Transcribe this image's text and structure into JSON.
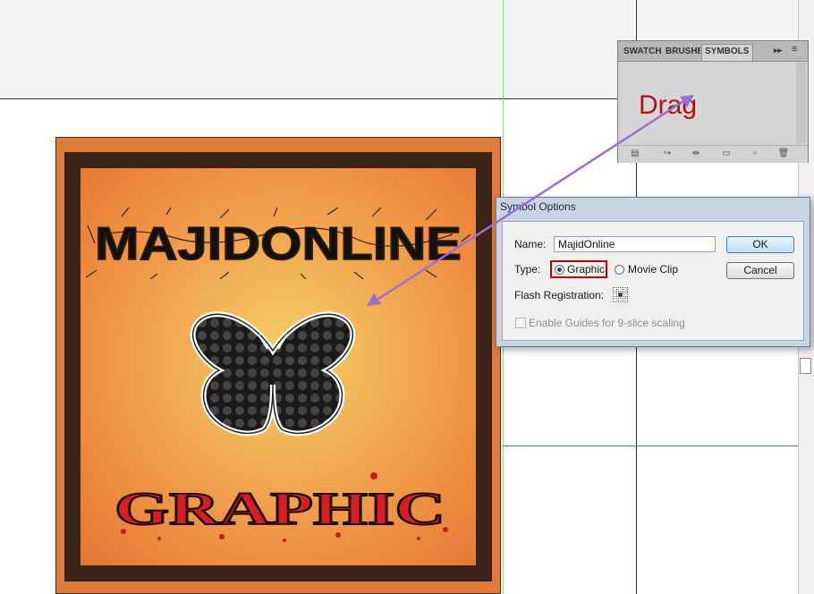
{
  "symbols_panel": {
    "tabs": [
      {
        "label": "SWATCHES",
        "active": false
      },
      {
        "label": "BRUSHES",
        "active": false
      },
      {
        "label": "SYMBOLS",
        "active": true
      }
    ],
    "footer_icons": [
      "symbol-libraries-icon",
      "place-symbol-instance-icon",
      "break-link-icon",
      "symbol-options-icon",
      "new-symbol-icon",
      "delete-symbol-icon"
    ]
  },
  "annotation": {
    "drag_text": "Drag",
    "color": "#b01219",
    "arrow_color": "#9b6fcf"
  },
  "artwork": {
    "title": "MAJIDONLINE",
    "subtitle": "GRAPHIC",
    "colors": {
      "outer": "#e07a3a",
      "frame": "#3b2315",
      "center": "#f6d068",
      "title": "#111111",
      "subtitle": "#d81f1f"
    }
  },
  "dialog": {
    "title": "Symbol Options",
    "name_label": "Name:",
    "name_value": "MajidOnline",
    "type_label": "Type:",
    "type_options": [
      "Graphic",
      "Movie Clip"
    ],
    "type_selected": "Graphic",
    "registration_label": "Flash Registration:",
    "guides_checkbox_label": "Enable Guides for 9-slice scaling",
    "guides_checked": false,
    "ok_label": "OK",
    "cancel_label": "Cancel"
  }
}
